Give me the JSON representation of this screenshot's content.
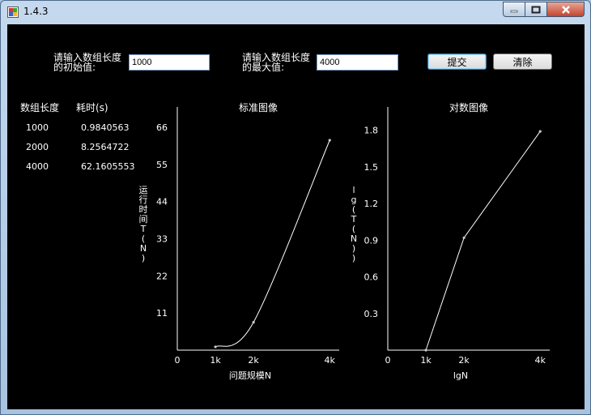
{
  "window": {
    "title": "1.4.3"
  },
  "form": {
    "start_label_line1": "请输入数组长度",
    "start_label_line2": "的初始值:",
    "start_value": "1000",
    "max_label_line1": "请输入数组长度",
    "max_label_line2": "的最大值:",
    "max_value": "4000",
    "submit_label": "提交",
    "clear_label": "清除"
  },
  "results": {
    "headers": [
      "数组长度",
      "耗时(s)"
    ],
    "rows": [
      {
        "size": "1000",
        "time": "0.9840563"
      },
      {
        "size": "2000",
        "time": "8.2564722"
      },
      {
        "size": "4000",
        "time": "62.1605553"
      }
    ]
  },
  "colors": {
    "background": "#000000",
    "foreground": "#ffffff"
  },
  "chart_data": [
    {
      "type": "line",
      "title": "标准图像",
      "xlabel": "问题规模N",
      "ylabel": "运行时间T(N)",
      "x_ticks": [
        "0",
        "1k",
        "2k",
        "4k"
      ],
      "x_tick_values": [
        0,
        1000,
        2000,
        4000
      ],
      "y_ticks": [
        "11",
        "22",
        "33",
        "44",
        "55",
        "66"
      ],
      "y_tick_values": [
        11,
        22,
        33,
        44,
        55,
        66
      ],
      "xlim": [
        0,
        4250
      ],
      "ylim": [
        0,
        72
      ],
      "grid": false,
      "series": [
        {
          "x": [
            1000,
            2000,
            4000
          ],
          "y": [
            0.98,
            8.26,
            62.16
          ]
        }
      ]
    },
    {
      "type": "line",
      "title": "对数图像",
      "xlabel": "lgN",
      "ylabel": "lg(T(N))",
      "x_ticks": [
        "0",
        "1k",
        "2k",
        "4k"
      ],
      "x_tick_values": [
        0,
        1000,
        2000,
        4000
      ],
      "y_ticks": [
        "0.3",
        "0.6",
        "0.9",
        "1.2",
        "1.5",
        "1.8"
      ],
      "y_tick_values": [
        0.3,
        0.6,
        0.9,
        1.2,
        1.5,
        1.8
      ],
      "xlim": [
        0,
        4250
      ],
      "ylim": [
        0,
        1.99
      ],
      "grid": false,
      "series": [
        {
          "x": [
            1000,
            2000,
            4000
          ],
          "y": [
            0.0,
            0.92,
            1.79
          ]
        }
      ]
    }
  ]
}
